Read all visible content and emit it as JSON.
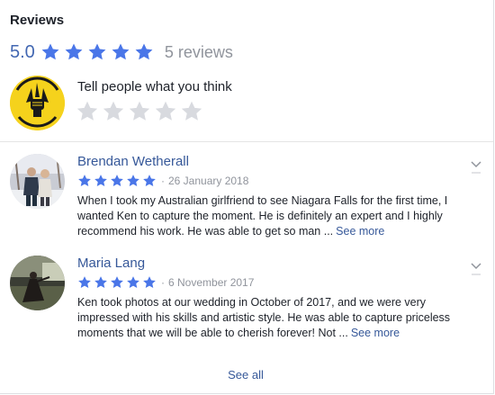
{
  "title": "Reviews",
  "summary": {
    "score": "5.0",
    "rating": 5,
    "count_label": "5 reviews"
  },
  "composer": {
    "prompt": "Tell people what you think",
    "rating": 0
  },
  "reviews": [
    {
      "name": "Brendan Wetherall",
      "rating": 5,
      "date": "26 January 2018",
      "text": "When I took my Australian girlfriend to see Niagara Falls for the first time, I wanted Ken to capture the moment. He is definitely an expert and I highly recommend his work. He was able to get so man ...",
      "see_more": "See more"
    },
    {
      "name": "Maria Lang",
      "rating": 5,
      "date": "6 November 2017",
      "text": "Ken took photos at our wedding in October of 2017, and we were very impressed with his skills and artistic style. He was able to capture priceless moments that we will be able to cherish forever! Not ...",
      "see_more": "See more"
    }
  ],
  "see_all": "See all",
  "colors": {
    "star_active": "#4a76e8",
    "star_inactive": "#d8dadf",
    "link": "#365899",
    "meta": "#90949c"
  },
  "icons": {
    "star": "star-icon",
    "chevron": "chevron-down-icon",
    "fist_logo": "raised-fist-logo"
  }
}
